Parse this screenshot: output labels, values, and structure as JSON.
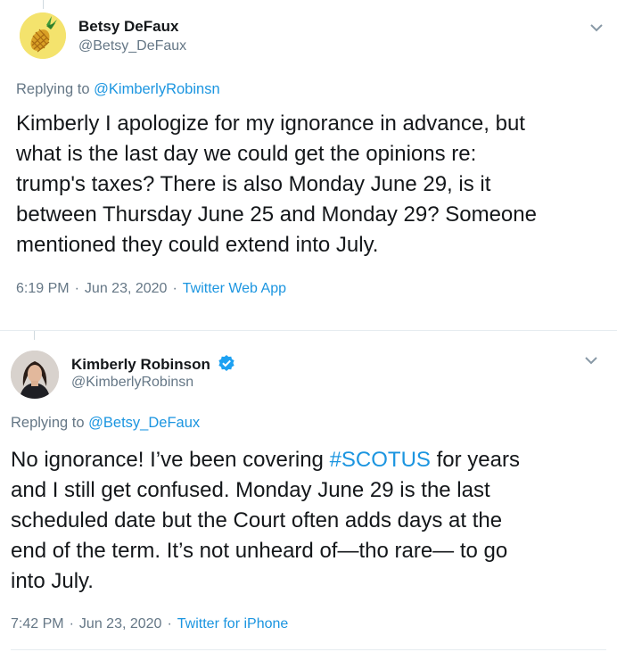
{
  "tweets": [
    {
      "author": {
        "name": "Betsy DeFaux",
        "handle": "@Betsy_DeFaux",
        "avatar_icon": "pineapple-icon"
      },
      "reply": {
        "prefix": "Replying to",
        "target": "@KimberlyRobinsn"
      },
      "body_lines": [
        "Kimberly I apologize for my ignorance in advance, but",
        "what is the last day we could get the opinions re:",
        "trump's taxes? There is also Monday June 29, is it",
        "between Thursday June 25 and Monday 29? Someone",
        "mentioned they could extend into July."
      ],
      "meta": {
        "time": "6:19 PM",
        "date": "Jun 23, 2020",
        "source": "Twitter Web App",
        "separator": "·"
      }
    },
    {
      "author": {
        "name": "Kimberly Robinson",
        "handle": "@KimberlyRobinsn",
        "avatar_icon": "profile-photo",
        "verified": true
      },
      "reply": {
        "prefix": "Replying to",
        "target": "@Betsy_DeFaux"
      },
      "body_lines": [
        {
          "before": "No ignorance! I’ve been covering ",
          "hashtag": "#SCOTUS",
          "after": " for years"
        },
        "and I still get confused. Monday June 29 is the last",
        "scheduled date but the Court often adds days at the",
        "end of the term. It’s not unheard of—tho rare— to go",
        "into July."
      ],
      "meta": {
        "time": "7:42 PM",
        "date": "Jun 23, 2020",
        "source": "Twitter for iPhone",
        "separator": "·"
      }
    }
  ],
  "colors": {
    "link": "#1b95e0",
    "secondary": "#657786",
    "text": "#14171a",
    "verified": "#1da1f2"
  }
}
